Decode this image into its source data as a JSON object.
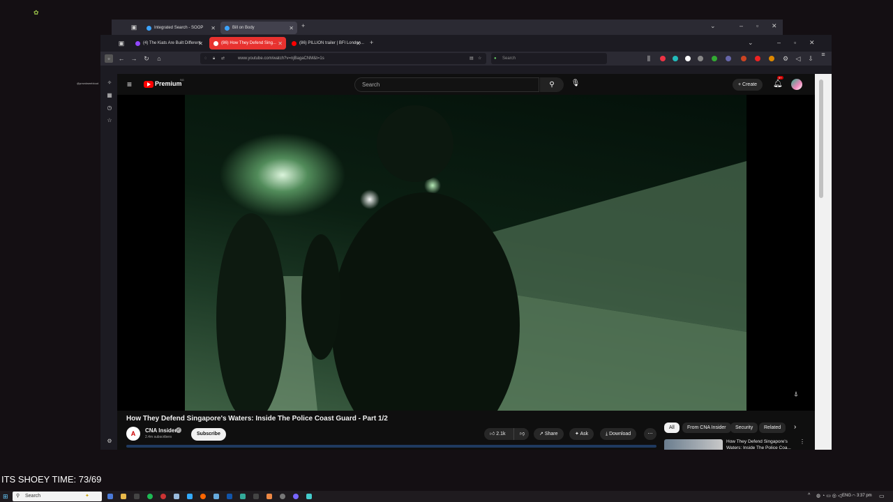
{
  "back_window": {
    "tabs": [
      {
        "label": "Integrated Search - SOOP"
      },
      {
        "label": "Bill on Body"
      }
    ]
  },
  "browser": {
    "tabs": [
      {
        "label": "(4) The Kiats Are Built Different"
      },
      {
        "label": "(86) How They Defend Sing..."
      },
      {
        "label": "(86) PILLION trailer | BFI London..."
      }
    ],
    "url": "www.youtube.com/watch?v=njBagaCNM&t=1s",
    "search_placeholder": "Search"
  },
  "side_user": "@prsedweebloud",
  "youtube": {
    "brand": "Premium",
    "brand_badge": "SG",
    "search_placeholder": "Search",
    "create_label": "Create",
    "notification_count": "9+",
    "video_title": "How They Defend Singapore's Waters: Inside The Police Coast Guard - Part 1/2",
    "channel_name": "CNA Insider",
    "subscribers": "2.4m subscribers",
    "subscribe_label": "Subscribe",
    "likes": "2.1k",
    "share_label": "Share",
    "ask_label": "Ask",
    "download_label": "Download",
    "chips": [
      "All",
      "From CNA Insider",
      "Security",
      "Related"
    ],
    "rec_title": "How They Defend Singapore's Waters: Inside The Police Coa..."
  },
  "overlay_text": "ITS SHOEY TIME: 73/69",
  "taskbar": {
    "search_label": "Search",
    "lang": "ENG",
    "time": "3:37 pm"
  }
}
